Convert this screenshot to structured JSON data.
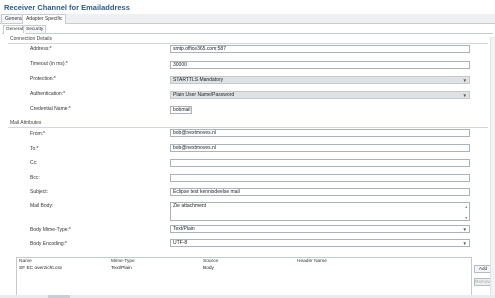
{
  "window": {
    "title": "Receiver Channel for Emailaddress"
  },
  "main_tabs": [
    {
      "label": "General"
    },
    {
      "label": "Adapter Specific"
    }
  ],
  "sub_tabs": [
    {
      "label": "General"
    },
    {
      "label": "Security"
    }
  ],
  "connection": {
    "section_title": "Connection Details",
    "address": {
      "label": "Address:*",
      "value": "smtp.office365.com:587"
    },
    "timeout": {
      "label": "Timeout (in ms):*",
      "value": "30000"
    },
    "protection": {
      "label": "Protection:*",
      "value": "STARTTLS Mandatory"
    },
    "authentication": {
      "label": "Authentication:*",
      "value": "Plain User Name/Password"
    },
    "credential": {
      "label": "Credential Name:*",
      "value": "bobmail"
    }
  },
  "mail": {
    "section_title": "Mail Attributes",
    "from": {
      "label": "From:*",
      "value": "bob@nextmoves.nl"
    },
    "to": {
      "label": "To:*",
      "value": "bob@nextmoves.nl"
    },
    "cc": {
      "label": "Cc:",
      "value": ""
    },
    "bcc": {
      "label": "Bcc:",
      "value": ""
    },
    "subject": {
      "label": "Subject:",
      "value": "Eclipse test kennisdeelse mail"
    },
    "body": {
      "label": "Mail Body:",
      "value": "Zie attachment"
    },
    "body_mime": {
      "label": "Body Mime-Type:*",
      "value": "Text/Plain"
    },
    "body_encoding": {
      "label": "Body Encoding:*",
      "value": "UTF-8"
    }
  },
  "attachments": {
    "columns": [
      "Name",
      "Mime-Type",
      "Source",
      "Header Name"
    ],
    "rows": [
      {
        "name": "SF EC overzicht.csv",
        "mime": "Text/Plain",
        "source": "Body",
        "header": ""
      }
    ],
    "add_label": "Add",
    "remove_label": "Remove"
  },
  "icons": {
    "dropdown": "chevron-down-icon",
    "scroll_up": "arrow-up-icon",
    "scroll_down": "arrow-down-icon"
  }
}
